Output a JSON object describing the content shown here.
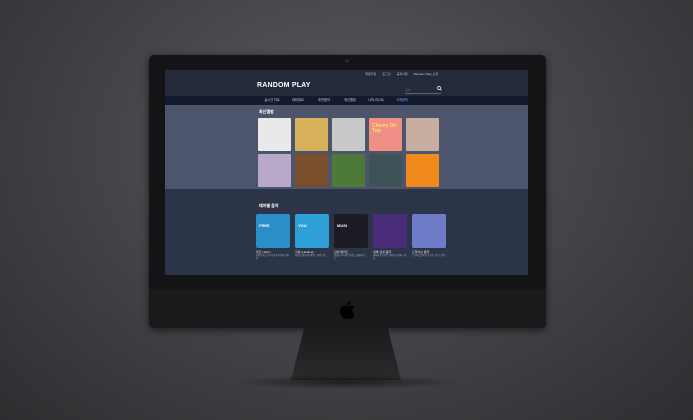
{
  "app": {
    "logo": "RANDOM PLAY",
    "util_links": [
      "회원가입",
      "로그인",
      "공지사항",
      "Random Play 소개"
    ],
    "search_placeholder": "검색..."
  },
  "nav": {
    "items": [
      "실시간 차트",
      "테마장르",
      "추천음악",
      "최신앨범",
      "나의 리스트",
      "고객센터"
    ],
    "active_index": 5
  },
  "section_latest": {
    "title": "최신앨범",
    "albums": [
      {
        "color": "#e9e9e9",
        "label": ""
      },
      {
        "color": "#d8b25a",
        "label": ""
      },
      {
        "color": "#c9c9c9",
        "label": ""
      },
      {
        "color": "#ef8f86",
        "label": "Cherry On Top"
      },
      {
        "color": "#c7aea1",
        "label": ""
      },
      {
        "color": "#b9a9c8",
        "label": ""
      },
      {
        "color": "#7a4f2e",
        "label": ""
      },
      {
        "color": "#4d7a3a",
        "label": ""
      },
      {
        "color": "#3d5357",
        "label": ""
      },
      {
        "color": "#f08a1c",
        "label": ""
      }
    ]
  },
  "section_playlist": {
    "title": "테마별 음악",
    "items": [
      {
        "title": "재즈 (Jazz)",
        "color": "#2a8fc9",
        "cover_text": "FREE",
        "desc": "잔잔한 재즈로 하루를 마무리해 보세요"
      },
      {
        "title": "힐링 (Healing)",
        "color": "#2f9fd8",
        "cover_text": "YOU",
        "desc": "마음을 편안하게 해주는 음악 모음"
      },
      {
        "title": "감성 발라드",
        "color": "#1c1c24",
        "cover_text": "MUSI",
        "desc": "감성을 자극하는 발라드 플레이리스트"
      },
      {
        "title": "새벽 감성 음악",
        "color": "#4a2d7a",
        "cover_text": "",
        "desc": "새벽에 듣기 좋은 음악을 추천해 드려요"
      },
      {
        "title": "드라이브 음악",
        "color": "#6f7dc9",
        "cover_text": "",
        "desc": "드라이브할 때 듣기 좋은 신나는 음악"
      }
    ]
  }
}
